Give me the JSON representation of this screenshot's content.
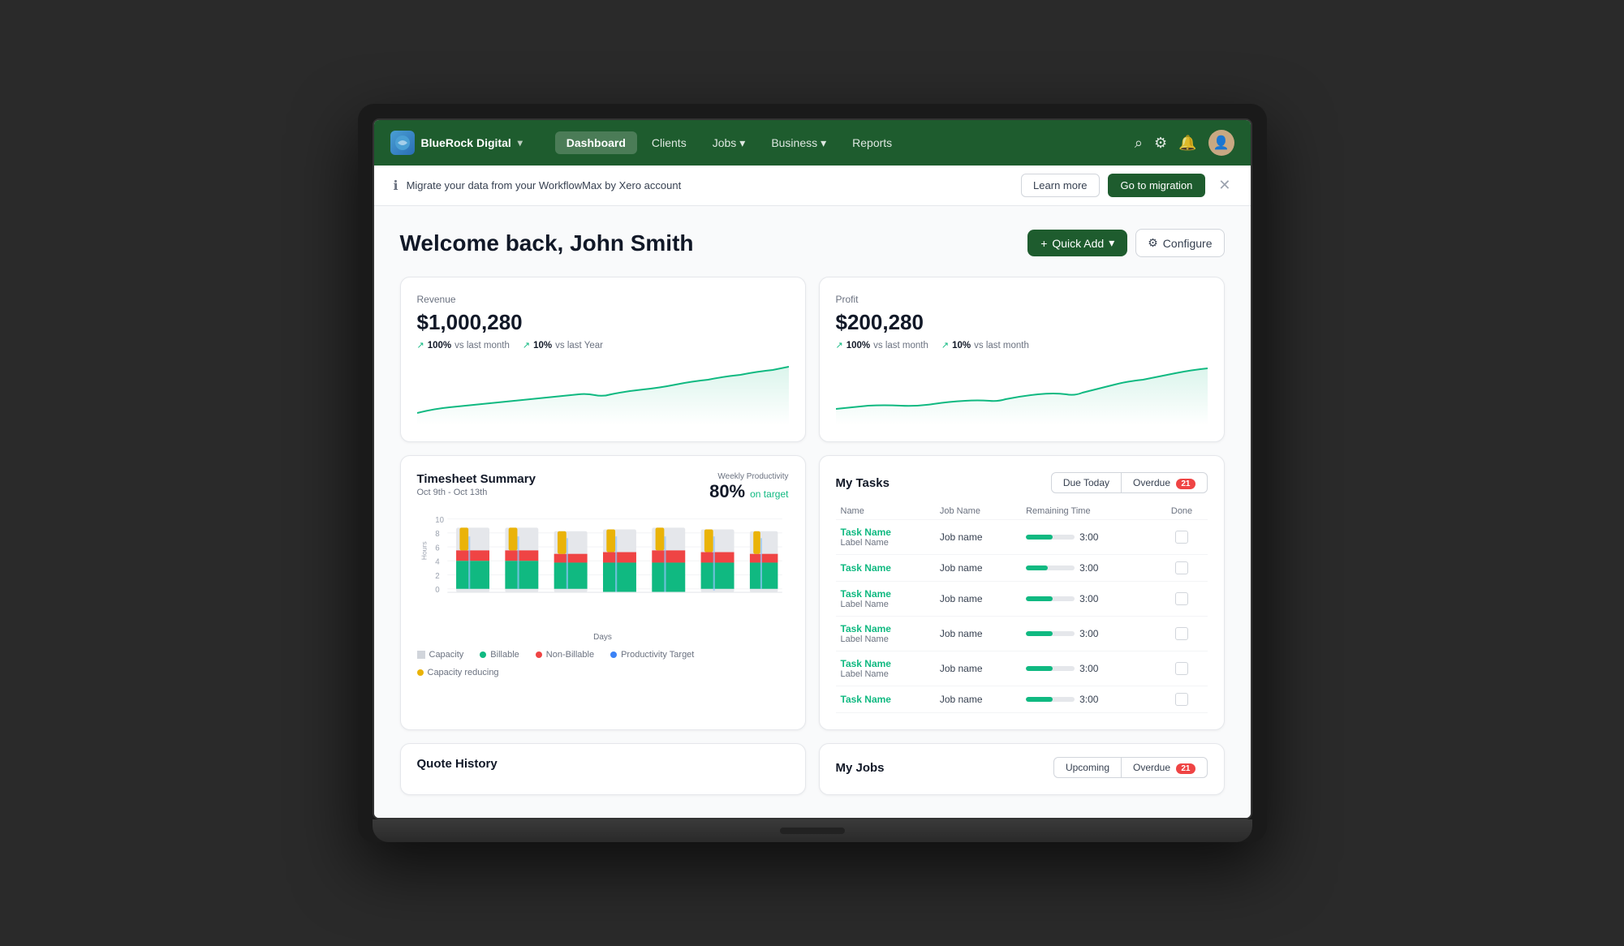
{
  "brand": {
    "name": "BlueRock Digital",
    "chevron": "▾"
  },
  "nav": {
    "links": [
      {
        "label": "Dashboard",
        "active": true,
        "hasChevron": false
      },
      {
        "label": "Clients",
        "active": false,
        "hasChevron": false
      },
      {
        "label": "Jobs",
        "active": false,
        "hasChevron": true
      },
      {
        "label": "Business",
        "active": false,
        "hasChevron": true
      },
      {
        "label": "Reports",
        "active": false,
        "hasChevron": false
      }
    ]
  },
  "banner": {
    "text": "Migrate your data from your WorkflowMax by Xero account",
    "learn_more": "Learn more",
    "go_migration": "Go to migration"
  },
  "page": {
    "title": "Welcome back, John Smith",
    "quick_add": "Quick Add",
    "configure": "Configure"
  },
  "revenue": {
    "label": "Revenue",
    "value": "$1,000,280",
    "stat1_pct": "100%",
    "stat1_label": "vs last month",
    "stat2_pct": "10%",
    "stat2_label": "vs last Year"
  },
  "profit": {
    "label": "Profit",
    "value": "$200,280",
    "stat1_pct": "100%",
    "stat1_label": "vs last month",
    "stat2_pct": "10%",
    "stat2_label": "vs last month"
  },
  "timesheet": {
    "title": "Timesheet Summary",
    "date_range": "Oct 9th - Oct 13th",
    "weekly_label": "Weekly Productivity",
    "pct": "80%",
    "on_target": "on target",
    "x_label": "Days",
    "y_labels": [
      "10",
      "8",
      "6",
      "4",
      "2",
      "0"
    ],
    "legend": [
      {
        "color": "#d1d5db",
        "label": "Capacity",
        "type": "square"
      },
      {
        "color": "#10b981",
        "label": "Billable",
        "type": "dot"
      },
      {
        "color": "#ef4444",
        "label": "Non-Billable",
        "type": "dot"
      },
      {
        "color": "#3b82f6",
        "label": "Productivity Target",
        "type": "dot"
      },
      {
        "color": "#eab308",
        "label": "Capacity reducing",
        "type": "dot"
      }
    ]
  },
  "tasks": {
    "title": "My Tasks",
    "tab_due": "Due Today",
    "tab_overdue": "Overdue",
    "overdue_count": "21",
    "columns": [
      "Name",
      "Job Name",
      "Remaining Time",
      "Done"
    ],
    "rows": [
      {
        "task": "Task Name",
        "label": "Label Name",
        "job": "Job name",
        "progress": 55,
        "time": "3:00"
      },
      {
        "task": "Task Name",
        "label": "",
        "job": "Job name",
        "progress": 45,
        "time": "3:00"
      },
      {
        "task": "Task Name",
        "label": "Label Name",
        "job": "Job name",
        "progress": 55,
        "time": "3:00"
      },
      {
        "task": "Task Name",
        "label": "Label Name",
        "job": "Job name",
        "progress": 55,
        "time": "3:00"
      },
      {
        "task": "Task Name",
        "label": "Label Name",
        "job": "Job name",
        "progress": 55,
        "time": "3:00"
      },
      {
        "task": "Task Name",
        "label": "",
        "job": "Job name",
        "progress": 55,
        "time": "3:00"
      }
    ]
  },
  "quote_history": {
    "title": "Quote History"
  },
  "my_jobs": {
    "title": "My Jobs",
    "tab_upcoming": "Upcoming",
    "tab_overdue": "Overdue",
    "overdue_count": "21"
  }
}
